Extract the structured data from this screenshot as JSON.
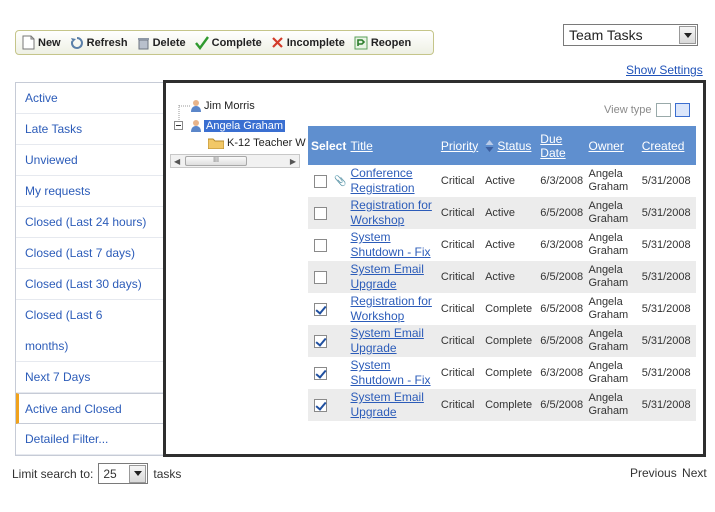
{
  "toolbar": {
    "new_label": "New",
    "refresh_label": "Refresh",
    "delete_label": "Delete",
    "complete_label": "Complete",
    "incomplete_label": "Incomplete",
    "reopen_label": "Reopen"
  },
  "team_select": {
    "value": "Team Tasks"
  },
  "show_settings": "Show Settings",
  "sidebar": {
    "items": [
      {
        "label": "Active"
      },
      {
        "label": "Late Tasks"
      },
      {
        "label": "Unviewed"
      },
      {
        "label": "My requests"
      },
      {
        "label": "Closed (Last 24 hours)"
      },
      {
        "label": "Closed (Last 7 days)"
      },
      {
        "label": "Closed (Last 30 days)"
      },
      {
        "label": "Closed (Last 6"
      },
      {
        "label": "months)"
      },
      {
        "label": "Next 7 Days"
      },
      {
        "label": "Active and Closed"
      },
      {
        "label": "Detailed Filter..."
      }
    ]
  },
  "tree": {
    "user1": "Jim Morris",
    "user2": "Angela Graham",
    "folder": "K-12 Teacher W"
  },
  "view_type_label": "View type",
  "table": {
    "headers": {
      "select": "Select",
      "title": "Title",
      "priority": "Priority",
      "status": "Status",
      "due_date_1": "Due",
      "due_date_2": "Date",
      "owner": "Owner",
      "created": "Created"
    },
    "rows": [
      {
        "title1": "Conference",
        "title2": "Registration",
        "priority": "Critical",
        "status": "Active",
        "due": "6/3/2008",
        "owner1": "Angela",
        "owner2": "Graham",
        "created": "5/31/2008",
        "checked": false,
        "attachment": true
      },
      {
        "title1": "Registration for",
        "title2": "Workshop",
        "priority": "Critical",
        "status": "Active",
        "due": "6/5/2008",
        "owner1": "Angela",
        "owner2": "Graham",
        "created": "5/31/2008",
        "checked": false,
        "attachment": false
      },
      {
        "title1": "System",
        "title2": "Shutdown - Fix",
        "priority": "Critical",
        "status": "Active",
        "due": "6/3/2008",
        "owner1": "Angela",
        "owner2": "Graham",
        "created": "5/31/2008",
        "checked": false,
        "attachment": false
      },
      {
        "title1": "System Email",
        "title2": "Upgrade",
        "priority": "Critical",
        "status": "Active",
        "due": "6/5/2008",
        "owner1": "Angela",
        "owner2": "Graham",
        "created": "5/31/2008",
        "checked": false,
        "attachment": false
      },
      {
        "title1": "Registration for",
        "title2": "Workshop",
        "priority": "Critical",
        "status": "Complete",
        "due": "6/5/2008",
        "owner1": "Angela",
        "owner2": "Graham",
        "created": "5/31/2008",
        "checked": true,
        "attachment": false
      },
      {
        "title1": "System Email",
        "title2": "Upgrade",
        "priority": "Critical",
        "status": "Complete",
        "due": "6/5/2008",
        "owner1": "Angela",
        "owner2": "Graham",
        "created": "5/31/2008",
        "checked": true,
        "attachment": false
      },
      {
        "title1": "System",
        "title2": "Shutdown - Fix",
        "priority": "Critical",
        "status": "Complete",
        "due": "6/3/2008",
        "owner1": "Angela",
        "owner2": "Graham",
        "created": "5/31/2008",
        "checked": true,
        "attachment": false
      },
      {
        "title1": "System Email",
        "title2": "Upgrade",
        "priority": "Critical",
        "status": "Complete",
        "due": "6/5/2008",
        "owner1": "Angela",
        "owner2": "Graham",
        "created": "5/31/2008",
        "checked": true,
        "attachment": false
      }
    ]
  },
  "footer": {
    "limit_label": "Limit search to:",
    "limit_value": "25",
    "limit_suffix": "tasks",
    "previous": "Previous",
    "next": "Next"
  }
}
